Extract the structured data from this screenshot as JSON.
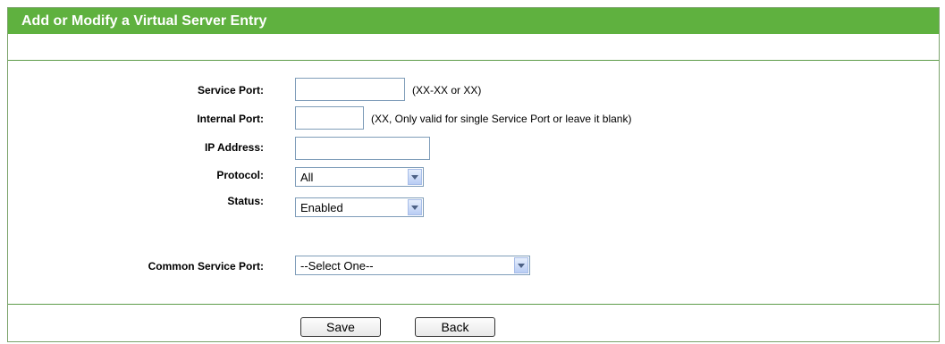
{
  "header": {
    "title": "Add or Modify a Virtual Server Entry"
  },
  "fields": {
    "service_port": {
      "label": "Service Port:",
      "value": "",
      "hint": "(XX-XX or XX)"
    },
    "internal_port": {
      "label": "Internal Port:",
      "value": "",
      "hint": "(XX, Only valid for single Service Port or leave it blank)"
    },
    "ip_address": {
      "label": "IP Address:",
      "value": ""
    },
    "protocol": {
      "label": "Protocol:",
      "value": "All"
    },
    "status": {
      "label": "Status:",
      "value": "Enabled"
    },
    "common_service_port": {
      "label": "Common Service Port:",
      "value": "--Select One--"
    }
  },
  "buttons": {
    "save": "Save",
    "back": "Back"
  },
  "colors": {
    "header_bg": "#5fb13f",
    "divider": "#5e9c4a"
  }
}
